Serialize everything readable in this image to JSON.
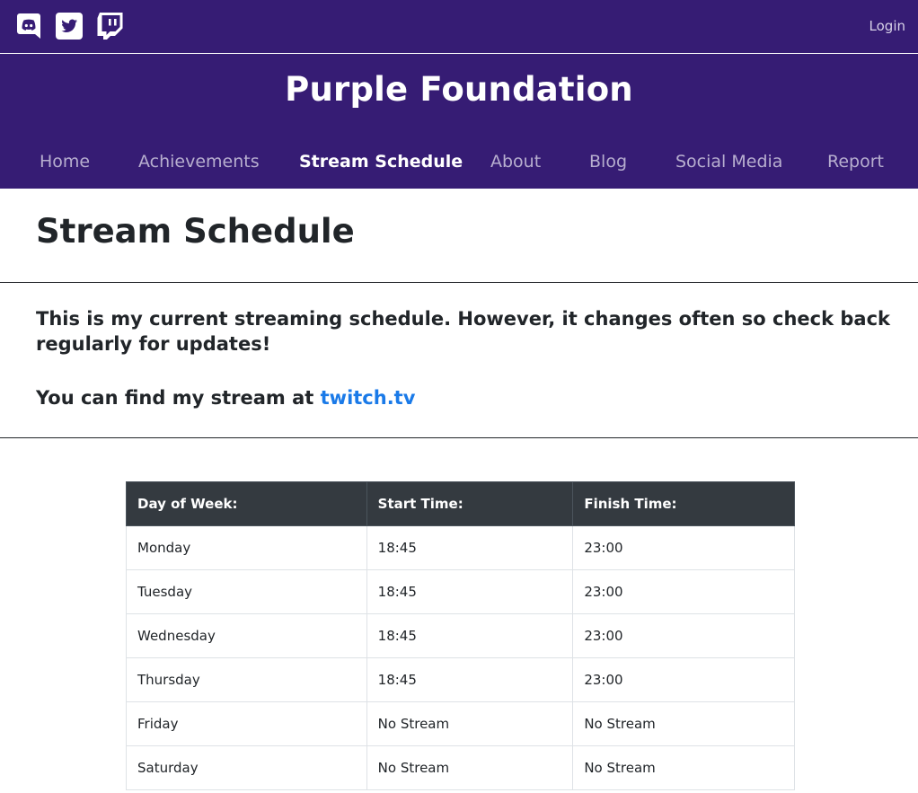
{
  "topbar": {
    "icons": [
      "discord-icon",
      "twitter-icon",
      "twitch-icon"
    ],
    "login_label": "Login"
  },
  "header": {
    "site_title": "Purple Foundation",
    "nav": [
      {
        "label": "Home",
        "active": false
      },
      {
        "label": "Achievements",
        "active": false
      },
      {
        "label": "Stream Schedule",
        "active": true
      },
      {
        "label": "About",
        "active": false
      },
      {
        "label": "Blog",
        "active": false
      },
      {
        "label": "Social Media",
        "active": false
      },
      {
        "label": "Report",
        "active": false
      }
    ]
  },
  "main": {
    "title": "Stream Schedule",
    "intro": "This is my current streaming schedule. However, it changes often so check back regularly for updates!",
    "find_prefix": "You can find my stream at ",
    "find_link": "twitch.tv"
  },
  "schedule": {
    "headers": [
      "Day of Week:",
      "Start Time:",
      "Finish Time:"
    ],
    "rows": [
      [
        "Monday",
        "18:45",
        "23:00"
      ],
      [
        "Tuesday",
        "18:45",
        "23:00"
      ],
      [
        "Wednesday",
        "18:45",
        "23:00"
      ],
      [
        "Thursday",
        "18:45",
        "23:00"
      ],
      [
        "Friday",
        "No Stream",
        "No Stream"
      ],
      [
        "Saturday",
        "No Stream",
        "No Stream"
      ]
    ]
  },
  "colors": {
    "header_bg": "#361c74",
    "nav_inactive": "#b7aecf",
    "link": "#1a7ae8",
    "table_header_bg": "#343a40"
  }
}
